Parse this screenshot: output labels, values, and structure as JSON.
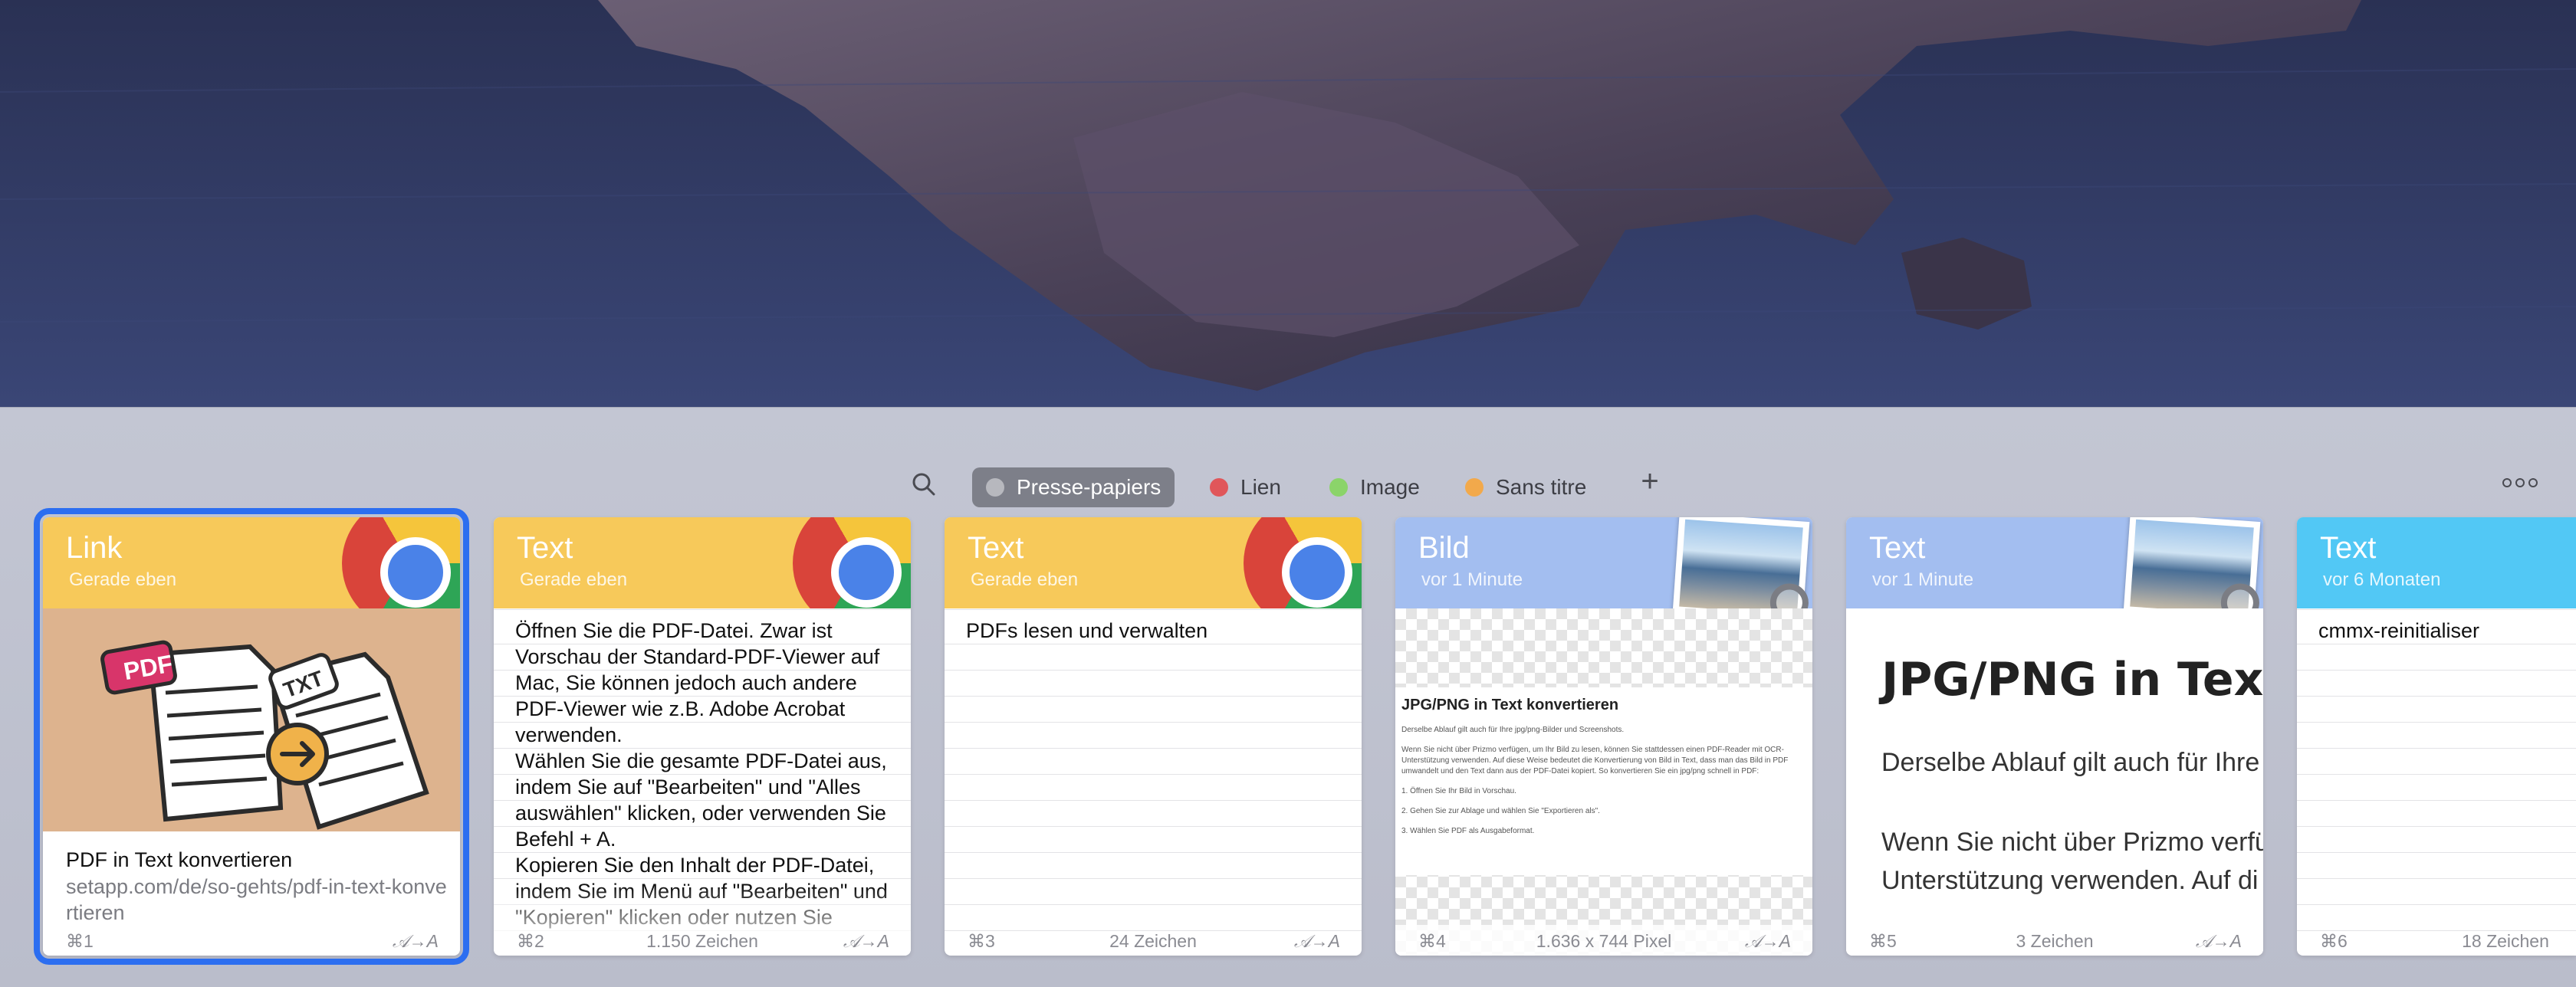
{
  "toolbar": {
    "search_icon": "search-icon",
    "pinboards": [
      {
        "label": "Presse-papiers",
        "color": "#b7b8be",
        "active": true
      },
      {
        "label": "Lien",
        "color": "#e0565a",
        "active": false
      },
      {
        "label": "Image",
        "color": "#8bd46a",
        "active": false
      },
      {
        "label": "Sans titre",
        "color": "#f2a94b",
        "active": false
      }
    ],
    "add_label": "+",
    "more_icon": "more-icon"
  },
  "cards": [
    {
      "type": "Link",
      "time": "Gerade eben",
      "app_icon": "chrome-icon",
      "link_title": "PDF in Text konvertieren",
      "link_url": "setapp.com/de/so-gehts/pdf-in-text-konvertieren",
      "image_labels": {
        "pdf": "PDF",
        "txt": "TXT"
      },
      "shortcut": "⌘1",
      "meta": "",
      "format": "𝒜→A",
      "selected": true
    },
    {
      "type": "Text",
      "time": "Gerade eben",
      "app_icon": "chrome-icon",
      "content": "Öffnen Sie die PDF-Datei. Zwar ist Vorschau der Standard-PDF-Viewer auf Mac, Sie können jedoch auch andere PDF-Viewer wie z.B. Adobe Acrobat verwenden.\nWählen Sie die gesamte PDF-Datei aus, indem Sie auf \"Bearbeiten\" und \"Alles auswählen\" klicken, oder verwenden Sie Befehl + A.\nKopieren Sie den Inhalt der PDF-Datei, indem Sie im Menü auf \"Bearbeiten\" und \"Kopieren\" klicken oder nutzen Sie",
      "shortcut": "⌘2",
      "meta": "1.150 Zeichen",
      "format": "𝒜→A"
    },
    {
      "type": "Text",
      "time": "Gerade eben",
      "app_icon": "chrome-icon",
      "content": "PDFs lesen und verwalten",
      "shortcut": "⌘3",
      "meta": "24 Zeichen",
      "format": "𝒜→A"
    },
    {
      "type": "Bild",
      "time": "vor 1 Minute",
      "app_icon": "preview-icon",
      "doc_heading": "JPG/PNG in Text konvertieren",
      "doc_sub": "Derselbe Ablauf gilt auch für Ihre jpg/png-Bilder und Screenshots.",
      "doc_para": "Wenn Sie nicht über Prizmo verfügen, um Ihr Bild zu lesen, können Sie stattdessen einen PDF-Reader mit OCR-Unterstützung verwenden. Auf diese Weise bedeutet die Konvertierung von Bild in Text, dass man das Bild in PDF umwandelt und den Text dann aus der PDF-Datei kopiert. So konvertieren Sie ein jpg/png schnell in PDF:",
      "doc_steps": [
        "1.  Öffnen Sie Ihr Bild in Vorschau.",
        "2.  Gehen Sie zur Ablage und wählen Sie \"Exportieren als\".",
        "3.  Wählen Sie PDF als Ausgabeformat."
      ],
      "shortcut": "⌘4",
      "meta": "1.636 x 744 Pixel",
      "format": "𝒜→A"
    },
    {
      "type": "Text",
      "time": "vor 1 Minute",
      "app_icon": "preview-icon",
      "heading": "JPG/PNG in Tex",
      "line1": "Derselbe Ablauf gilt auch für Ihre",
      "line2": "Wenn Sie nicht über Prizmo verfü",
      "line3": "Unterstützung verwenden. Auf di",
      "shortcut": "⌘5",
      "meta": "3 Zeichen",
      "format": "𝒜→A"
    },
    {
      "type": "Text",
      "time": "vor 6 Monaten",
      "content": "cmmx-reinitialiser",
      "shortcut": "⌘6",
      "meta": "18 Zeichen"
    }
  ],
  "colors": {
    "accent": "#2c6ef0",
    "text_header": "#f7c95a",
    "image_header": "#a3bef0",
    "cyan_header": "#52c8f5"
  }
}
